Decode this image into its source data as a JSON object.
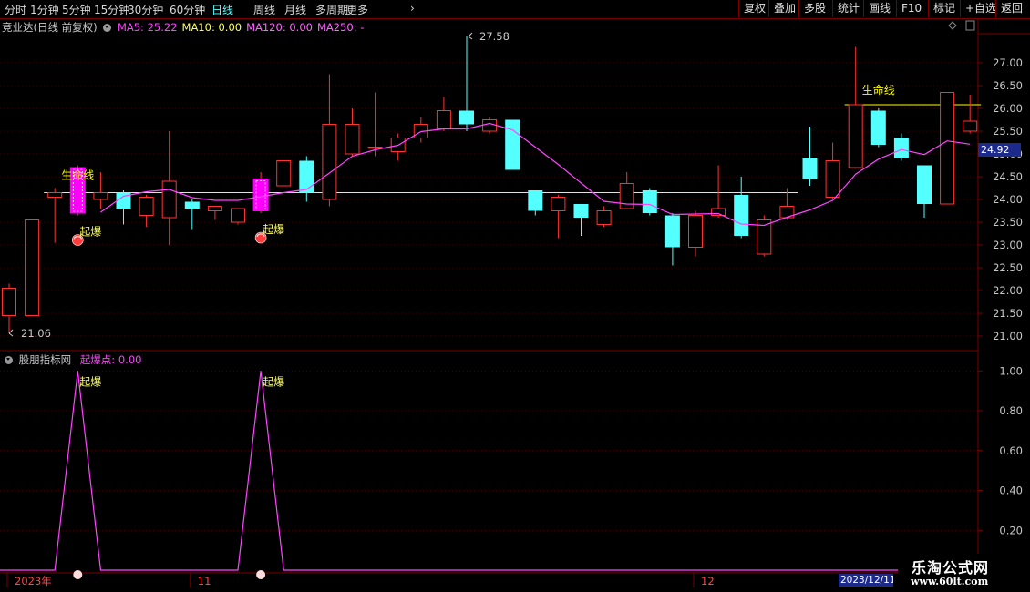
{
  "toolbar": {
    "periods": [
      "分时",
      "1分钟",
      "5分钟",
      "15分钟",
      "30分钟",
      "60分钟",
      "日线",
      "周线",
      "月线",
      "多周期",
      "更多"
    ],
    "active_period": "日线",
    "more_arrow": "›",
    "right_buttons": [
      "复权",
      "叠加",
      "多股",
      "统计",
      "画线",
      "F10",
      "标记",
      "+自选",
      "返回"
    ]
  },
  "main_panel": {
    "title": "竞业达(日线 前复权)",
    "ma": [
      {
        "label": "MA5: 25.22",
        "color": "#ff44ff"
      },
      {
        "label": "MA10: 0.00",
        "color": "#ffff55"
      },
      {
        "label": "MA120: 0.00",
        "color": "#ff66ff"
      },
      {
        "label": "MA250: -",
        "color": "#ff66ff"
      }
    ],
    "high_label": "27.58",
    "low_label": "21.06",
    "life_line_label": "生命线",
    "signal_label": "起爆",
    "current_price": "24.92"
  },
  "sub_panel": {
    "title": "股朋指标网",
    "value_label": "起爆点: 0.00"
  },
  "date_axis": {
    "labels": [
      {
        "text": "2023年",
        "index": 0
      },
      {
        "text": "11",
        "index": 8
      },
      {
        "text": "12",
        "index": 30
      }
    ],
    "current_date": "2023/12/11"
  },
  "watermark": {
    "title": "乐淘公式网",
    "url": "www.60lt.com"
  },
  "colors": {
    "up": "#ff3232",
    "down": "#54ffff",
    "signal_candle": "#ff00ff",
    "ma5": "#ff44ff",
    "life_line": "#ffff00",
    "grid": "#7a0000",
    "axis_text": "#c8c8c8"
  },
  "chart_data": {
    "type": "candlestick",
    "y_axis": {
      "min": 21.0,
      "max": 27.0,
      "ticks": [
        21.0,
        21.5,
        22.0,
        22.5,
        23.0,
        23.5,
        24.0,
        24.5,
        25.0,
        25.5,
        26.0,
        26.5,
        27.0
      ]
    },
    "life_line_levels": [
      {
        "value": 24.15,
        "from": 2,
        "to": 34
      },
      {
        "value": 26.08,
        "from": 37,
        "to": 42
      }
    ],
    "candles": [
      {
        "o": 21.45,
        "c": 22.05,
        "h": 22.15,
        "l": 21.06
      },
      {
        "o": 21.45,
        "c": 23.55,
        "h": 23.55,
        "l": 21.45
      },
      {
        "o": 24.05,
        "c": 24.15,
        "h": 24.25,
        "l": 23.05
      },
      {
        "o": 23.7,
        "c": 24.7,
        "h": 24.75,
        "l": 23.65,
        "signal": true
      },
      {
        "o": 24.0,
        "c": 24.15,
        "h": 24.6,
        "l": 23.8
      },
      {
        "o": 24.15,
        "c": 23.8,
        "h": 24.2,
        "l": 23.45
      },
      {
        "o": 23.65,
        "c": 24.05,
        "h": 24.1,
        "l": 23.4
      },
      {
        "o": 23.6,
        "c": 24.4,
        "h": 25.5,
        "l": 23.0
      },
      {
        "o": 23.95,
        "c": 23.8,
        "h": 24.0,
        "l": 23.35
      },
      {
        "o": 23.75,
        "c": 23.85,
        "h": 23.85,
        "l": 23.55
      },
      {
        "o": 23.5,
        "c": 23.8,
        "h": 23.8,
        "l": 23.45
      },
      {
        "o": 23.75,
        "c": 24.45,
        "h": 24.6,
        "l": 23.7,
        "signal": true
      },
      {
        "o": 24.3,
        "c": 24.85,
        "h": 24.85,
        "l": 24.3
      },
      {
        "o": 24.85,
        "c": 24.15,
        "h": 24.95,
        "l": 23.95
      },
      {
        "o": 24.0,
        "c": 25.65,
        "h": 26.75,
        "l": 23.85
      },
      {
        "o": 25.0,
        "c": 25.65,
        "h": 26.0,
        "l": 24.95
      },
      {
        "o": 25.15,
        "c": 25.15,
        "h": 26.35,
        "l": 24.95
      },
      {
        "o": 25.05,
        "c": 25.35,
        "h": 25.45,
        "l": 24.85
      },
      {
        "o": 25.35,
        "c": 25.65,
        "h": 25.8,
        "l": 25.25
      },
      {
        "o": 25.55,
        "c": 25.95,
        "h": 26.25,
        "l": 25.5
      },
      {
        "o": 25.95,
        "c": 25.65,
        "h": 27.58,
        "l": 25.5
      },
      {
        "o": 25.5,
        "c": 25.75,
        "h": 25.8,
        "l": 25.45
      },
      {
        "o": 25.75,
        "c": 24.65,
        "h": 25.75,
        "l": 24.65
      },
      {
        "o": 24.2,
        "c": 23.75,
        "h": 24.2,
        "l": 23.65
      },
      {
        "o": 23.75,
        "c": 24.05,
        "h": 24.1,
        "l": 23.15
      },
      {
        "o": 23.9,
        "c": 23.6,
        "h": 23.9,
        "l": 23.2
      },
      {
        "o": 23.45,
        "c": 23.75,
        "h": 23.85,
        "l": 23.4
      },
      {
        "o": 23.8,
        "c": 24.35,
        "h": 24.6,
        "l": 23.8
      },
      {
        "o": 24.2,
        "c": 23.7,
        "h": 24.25,
        "l": 23.65
      },
      {
        "o": 23.65,
        "c": 22.95,
        "h": 23.7,
        "l": 22.55
      },
      {
        "o": 22.95,
        "c": 23.65,
        "h": 23.75,
        "l": 22.75
      },
      {
        "o": 23.65,
        "c": 23.8,
        "h": 24.75,
        "l": 23.6
      },
      {
        "o": 24.1,
        "c": 23.2,
        "h": 24.5,
        "l": 23.15
      },
      {
        "o": 22.8,
        "c": 23.55,
        "h": 23.65,
        "l": 22.75
      },
      {
        "o": 23.6,
        "c": 23.85,
        "h": 24.25,
        "l": 23.55
      },
      {
        "o": 24.9,
        "c": 24.45,
        "h": 25.6,
        "l": 24.3
      },
      {
        "o": 24.05,
        "c": 24.85,
        "h": 25.25,
        "l": 24.0
      },
      {
        "o": 24.7,
        "c": 26.08,
        "h": 27.35,
        "l": 24.7
      },
      {
        "o": 25.95,
        "c": 25.2,
        "h": 26.0,
        "l": 25.15
      },
      {
        "o": 25.35,
        "c": 24.9,
        "h": 25.45,
        "l": 24.85
      },
      {
        "o": 24.75,
        "c": 23.9,
        "h": 24.75,
        "l": 23.6
      },
      {
        "o": 23.9,
        "c": 26.35,
        "h": 26.35,
        "l": 23.9
      },
      {
        "o": 25.5,
        "c": 25.72,
        "h": 26.3,
        "l": 25.45
      }
    ],
    "ma5": [
      null,
      null,
      null,
      null,
      23.65,
      23.9,
      23.98,
      24.1,
      24.02,
      23.95,
      23.93,
      23.97,
      24.08,
      24.2,
      24.45,
      24.7,
      24.95,
      25.05,
      25.15,
      25.35,
      25.5,
      25.55,
      25.58,
      25.55,
      25.4,
      25.15,
      24.85,
      24.45,
      24.1,
      23.85,
      23.75,
      23.68,
      23.62,
      23.45,
      23.38,
      23.45,
      23.6,
      23.75,
      24.05,
      24.6,
      25.0,
      25.2,
      25.15,
      25.05,
      25.15,
      25.22
    ],
    "indicator": {
      "name": "起爆点",
      "y_ticks": [
        0.2,
        0.4,
        0.6,
        0.8,
        1.0
      ],
      "values": [
        0,
        0,
        0,
        1,
        0,
        0,
        0,
        0,
        0,
        0,
        0,
        1,
        0,
        0,
        0,
        0,
        0,
        0,
        0,
        0,
        0,
        0,
        0,
        0,
        0,
        0,
        0,
        0,
        0,
        0,
        0,
        0,
        0,
        0,
        0,
        0,
        0,
        0,
        0,
        0,
        0,
        0,
        0
      ]
    }
  }
}
